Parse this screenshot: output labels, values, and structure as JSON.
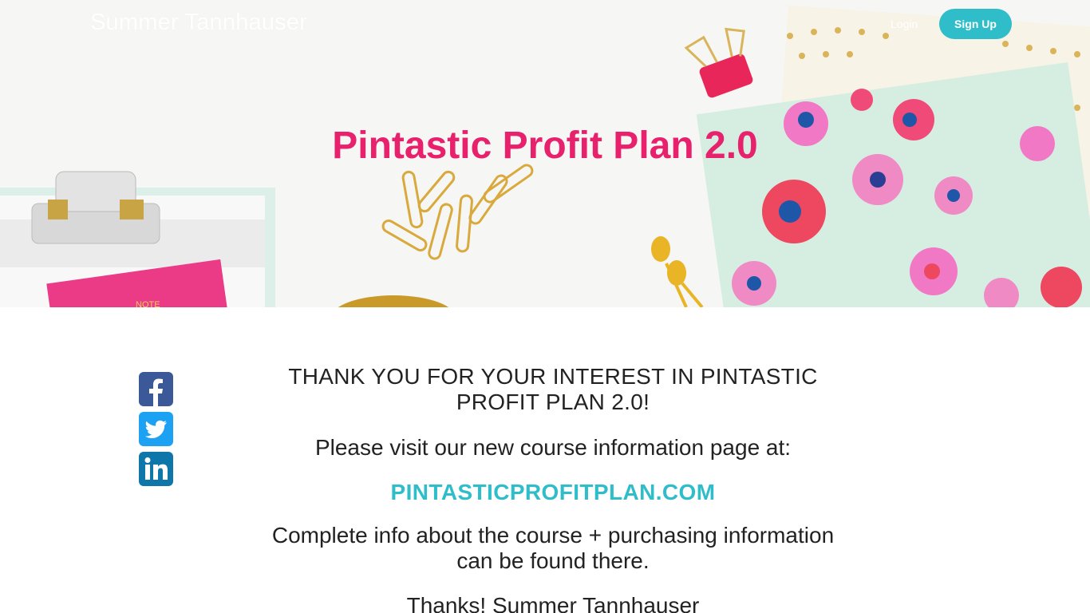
{
  "nav": {
    "brand": "Summer Tannhauser",
    "login_label": "Login",
    "signup_label": "Sign Up"
  },
  "hero": {
    "title": "Pintastic Profit Plan 2.0",
    "note_text": "NOTE"
  },
  "social": [
    {
      "name": "facebook",
      "icon": "facebook-icon",
      "color": "#3b5998"
    },
    {
      "name": "twitter",
      "icon": "twitter-icon",
      "color": "#1da1f2"
    },
    {
      "name": "linkedin",
      "icon": "linkedin-icon",
      "color": "#0e76a8"
    }
  ],
  "main": {
    "heading": "THANK YOU FOR YOUR INTEREST IN PINTASTIC PROFIT PLAN 2.0!",
    "visit_text": "Please visit our new course information page at:",
    "link_text": "PINTASTICPROFITPLAN.COM",
    "info_text": "Complete info about the course + purchasing information can be found there.",
    "thanks_text": "Thanks! Summer Tannhauser"
  },
  "colors": {
    "accent": "#2ebdc9",
    "title_pink": "#e8216d",
    "text": "#222222"
  }
}
